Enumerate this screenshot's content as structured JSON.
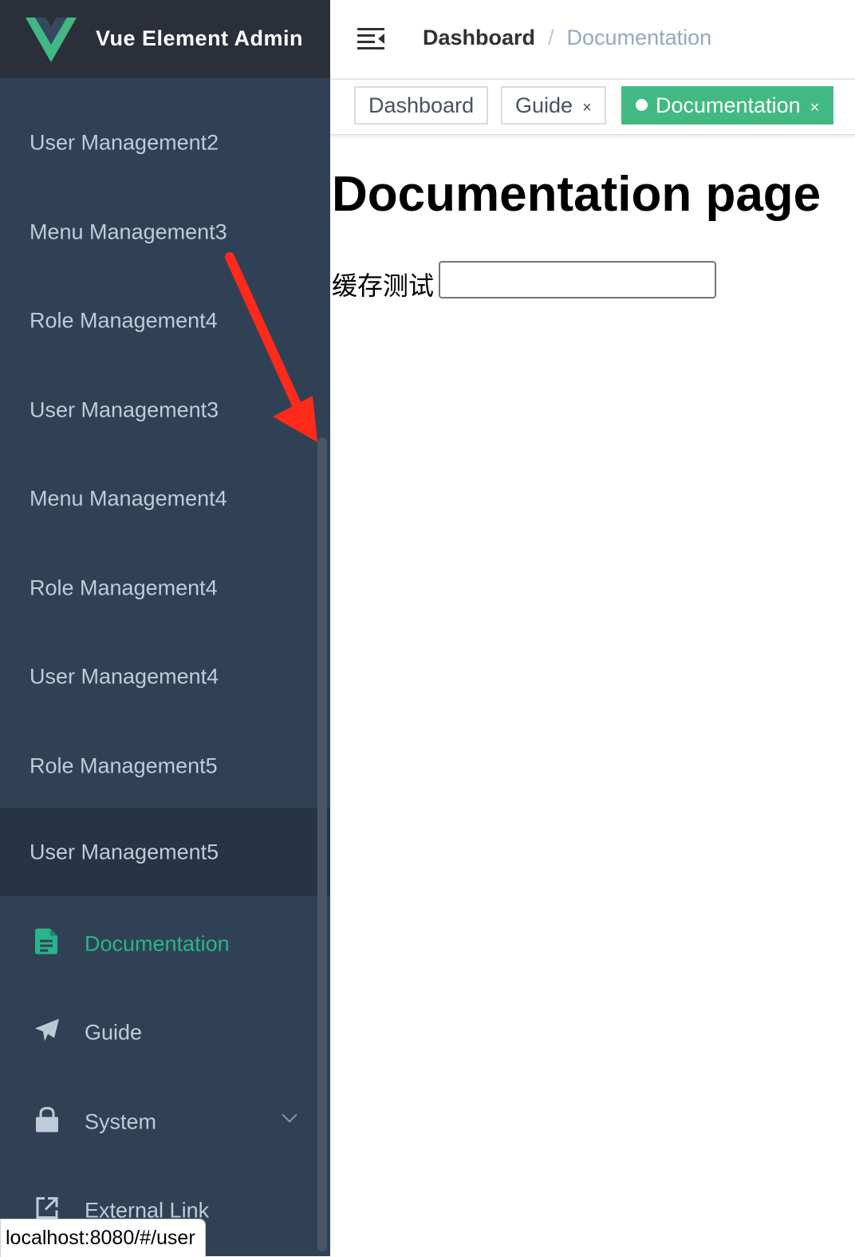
{
  "app": {
    "title": "Vue Element Admin"
  },
  "sidebar": {
    "items": [
      {
        "label": "User Management2"
      },
      {
        "label": "Menu Management3"
      },
      {
        "label": "Role Management4"
      },
      {
        "label": "User Management3"
      },
      {
        "label": "Menu Management4"
      },
      {
        "label": "Role Management4"
      },
      {
        "label": "User Management4"
      },
      {
        "label": "Role Management5"
      },
      {
        "label": "User Management5"
      },
      {
        "label": "Documentation",
        "icon": "document-icon"
      },
      {
        "label": "Guide",
        "icon": "paper-plane-icon"
      },
      {
        "label": "System",
        "icon": "lock-icon"
      },
      {
        "label": "External Link",
        "icon": "external-link-icon"
      }
    ]
  },
  "navbar": {
    "breadcrumb": [
      "Dashboard",
      "Documentation"
    ],
    "separator": "/"
  },
  "tags": [
    {
      "label": "Dashboard",
      "closable": false,
      "active": false
    },
    {
      "label": "Guide",
      "closable": true,
      "active": false
    },
    {
      "label": "Documentation",
      "closable": true,
      "active": true
    }
  ],
  "tag_close_glyph": "×",
  "main": {
    "heading": "Documentation page",
    "cache_label": "缓存测试",
    "cache_value": ""
  },
  "statusbar": {
    "url": "localhost:8080/#/user"
  },
  "colors": {
    "sidebar_bg": "#304156",
    "logo_bg": "#2b2f3a",
    "accent": "#42b983",
    "active_text": "#29b48b",
    "annotation": "#ff2a1a"
  }
}
